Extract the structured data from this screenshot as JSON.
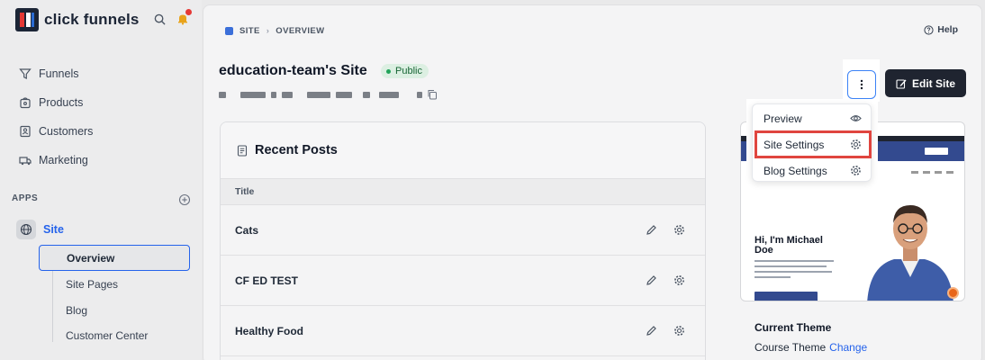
{
  "brand": {
    "name": "click funnels"
  },
  "sidebar": {
    "nav": [
      {
        "label": "Funnels",
        "icon": "funnel-icon"
      },
      {
        "label": "Products",
        "icon": "box-icon"
      },
      {
        "label": "Customers",
        "icon": "contact-card-icon"
      },
      {
        "label": "Marketing",
        "icon": "truck-icon"
      }
    ],
    "apps_label": "APPS",
    "site_label": "Site",
    "subnav": [
      "Overview",
      "Site Pages",
      "Blog",
      "Customer Center"
    ]
  },
  "header": {
    "breadcrumb": [
      "SITE",
      "OVERVIEW"
    ],
    "help_label": "Help"
  },
  "page": {
    "title": "education-team's Site",
    "status_badge": "Public",
    "edit_button": "Edit Site"
  },
  "posts": {
    "heading": "Recent Posts",
    "column_title": "Title",
    "rows": [
      "Cats",
      "CF ED TEST",
      "Healthy Food"
    ]
  },
  "dropdown": {
    "items": [
      {
        "label": "Preview",
        "icon": "eye-icon"
      },
      {
        "label": "Site Settings",
        "icon": "gear-icon"
      },
      {
        "label": "Blog Settings",
        "icon": "gear-icon"
      }
    ]
  },
  "preview": {
    "hero_text": "Hi, I'm Michael Doe"
  },
  "theme": {
    "label": "Current Theme",
    "name": "Course Theme",
    "change_link": "Change"
  },
  "colors": {
    "accent": "#2563eb",
    "dark_button": "#1f2430",
    "highlight_red": "#e0453f",
    "badge_green": "#dcefe2"
  }
}
